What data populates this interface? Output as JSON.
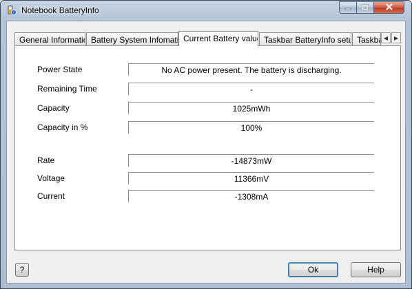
{
  "window": {
    "title": "Notebook BatteryInfo",
    "controls": {
      "minimize": "minimize-icon",
      "maximize": "maximize-icon",
      "close": "close-icon"
    }
  },
  "tabs": [
    {
      "label": "General Information",
      "active": false
    },
    {
      "label": "Battery System Infomation",
      "active": false
    },
    {
      "label": "Current Battery values",
      "active": true
    },
    {
      "label": "Taskbar BatteryInfo setup",
      "active": false
    },
    {
      "label": "Taskbar",
      "active": false
    }
  ],
  "fields": {
    "power_state": {
      "label": "Power State",
      "value": "No AC power present. The battery is discharging."
    },
    "remaining_time": {
      "label": "Remaining Time",
      "value": "-"
    },
    "capacity": {
      "label": "Capacity",
      "value": "1025mWh"
    },
    "capacity_pct": {
      "label": "Capacity in %",
      "value": "100%"
    },
    "rate": {
      "label": "Rate",
      "value": "-14873mW"
    },
    "voltage": {
      "label": "Voltage",
      "value": "11366mV"
    },
    "current": {
      "label": "Current",
      "value": "-1308mA"
    }
  },
  "buttons": {
    "help_q": "?",
    "ok": "Ok",
    "help": "Help"
  },
  "colors": {
    "titlebar": "#b2c3d6",
    "close": "#c9452b",
    "panel": "#ffffff",
    "client": "#f0f0f0"
  }
}
